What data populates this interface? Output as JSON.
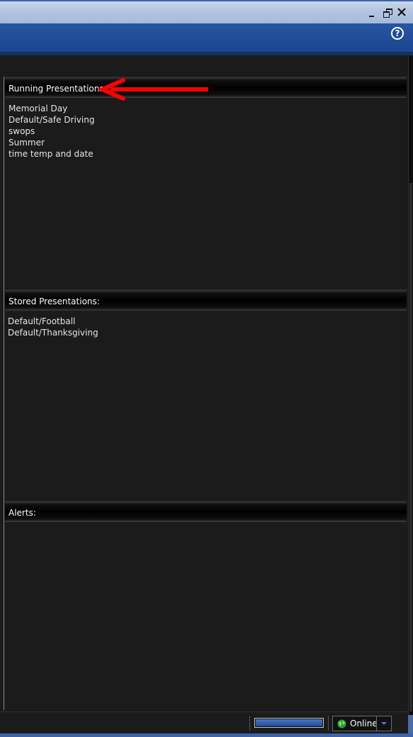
{
  "window": {
    "minimize_glyph": "_",
    "help_glyph": "?"
  },
  "sections": {
    "running": {
      "title": "Running Presentations:",
      "items": [
        "Memorial Day",
        "Default/Safe Driving",
        "swops",
        "Summer",
        "time temp and date"
      ]
    },
    "stored": {
      "title": "Stored Presentations:",
      "items": [
        "Default/Football",
        "Default/Thanksgiving"
      ]
    },
    "alerts": {
      "title": "Alerts:",
      "items": []
    }
  },
  "annotation": {
    "arrow_color": "#ff0000",
    "points_to": "running-presentations-header"
  },
  "statusbar": {
    "progress_fraction": 1.0,
    "status_label": "Online",
    "status_color": "#3fc43f"
  },
  "colors": {
    "appbar": "#1f4c98",
    "panel_bg": "#1b1b1b",
    "titlebar": "#b3c5e1"
  },
  "icons": {
    "help": "help-circle-icon",
    "status": "green-globe-icon",
    "dropdown": "chevron-down-icon"
  }
}
